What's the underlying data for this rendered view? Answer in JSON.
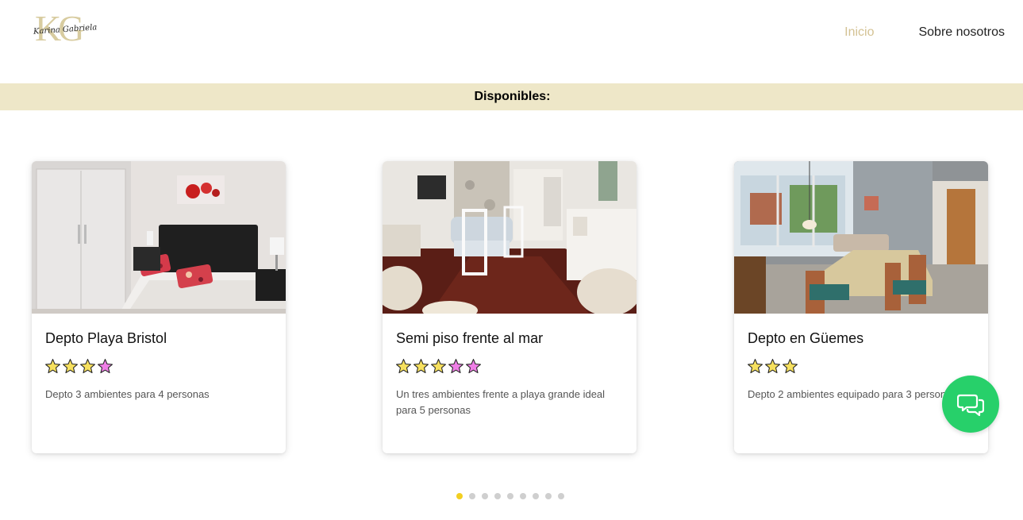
{
  "brand": {
    "logo_monogram": "KG",
    "logo_signature": "Karina Gabriela"
  },
  "nav": {
    "items": [
      {
        "label": "Inicio",
        "active": true,
        "color": "#d4c294"
      },
      {
        "label": "Sobre nosotros",
        "active": false,
        "color": "#222222"
      }
    ]
  },
  "banner": {
    "label": "Disponibles:",
    "background": "#eee7c8"
  },
  "listings": [
    {
      "title": "Depto Playa Bristol",
      "description": "Depto 3 ambientes para 4 personas",
      "rating_icons": [
        "star-yellow",
        "star-yellow",
        "star-yellow",
        "star-pink"
      ],
      "photo": "bedroom-photo"
    },
    {
      "title": "Semi piso frente al mar",
      "description": "Un tres ambientes frente a playa grande ideal para 5 personas",
      "rating_icons": [
        "star-yellow",
        "star-yellow",
        "star-yellow",
        "star-pink",
        "star-pink"
      ],
      "photo": "dining-room-photo"
    },
    {
      "title": "Depto en Güemes",
      "description": "Depto 2 ambientes equipado para 3 personas",
      "rating_icons": [
        "star-yellow",
        "star-yellow",
        "star-yellow"
      ],
      "photo": "living-dining-photo"
    }
  ],
  "carousel": {
    "dot_count": 9,
    "active_index": 0,
    "active_color": "#f2cf21",
    "inactive_color": "#cfcfcf"
  },
  "chat": {
    "icon": "chat-bubbles-icon",
    "color": "#27d06a"
  },
  "colors": {
    "star_yellow": "#f6e05e",
    "star_pink": "#ef7ee6"
  }
}
